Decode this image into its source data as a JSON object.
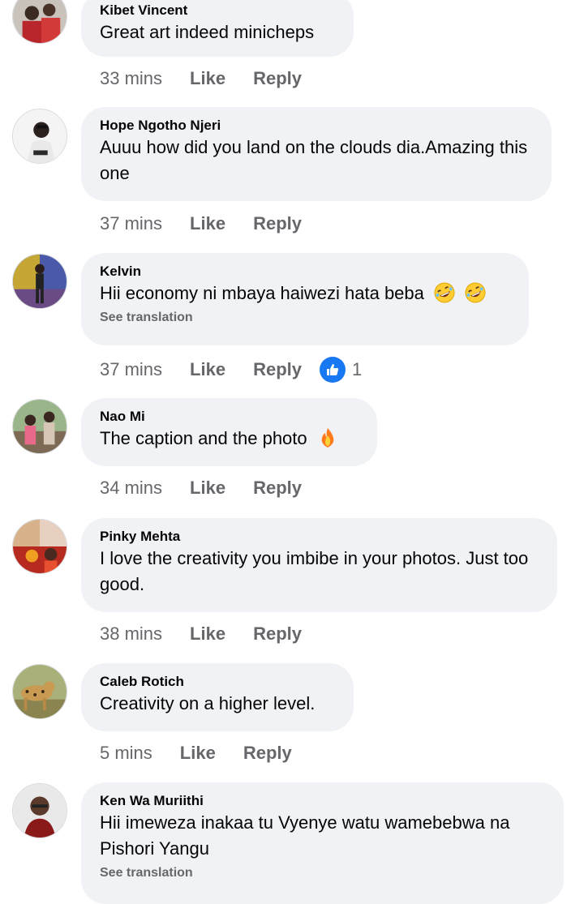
{
  "comments": [
    {
      "author": "Kibet Vincent",
      "text": "Great art indeed minicheps",
      "time": "33 mins",
      "like": "Like",
      "reply": "Reply"
    },
    {
      "author": "Hope Ngotho Njeri",
      "text": "Auuu how did you land on the clouds dia.Amazing this one",
      "time": "37 mins",
      "like": "Like",
      "reply": "Reply"
    },
    {
      "author": "Kelvin",
      "text": "Hii economy ni mbaya haiwezi hata beba",
      "emoji": [
        "rolling-on-floor-laughing-emoji",
        "rolling-on-floor-laughing-emoji"
      ],
      "see_translation": "See translation",
      "time": "37 mins",
      "like": "Like",
      "reply": "Reply",
      "reaction_count": "1"
    },
    {
      "author": "Nao Mi",
      "text": "The caption and the photo",
      "emoji": [
        "fire-emoji"
      ],
      "time": "34 mins",
      "like": "Like",
      "reply": "Reply"
    },
    {
      "author": "Pinky Mehta",
      "text": "I love the creativity you imbibe in your photos. Just too good.",
      "time": "38 mins",
      "like": "Like",
      "reply": "Reply"
    },
    {
      "author": "Caleb Rotich",
      "text": "Creativity on a higher level.",
      "time": "5 mins",
      "like": "Like",
      "reply": "Reply"
    },
    {
      "author": "Ken Wa Muriithi",
      "text": "Hii imeweza inakaa tu Vyenye watu wamebebwa na Pishori Yangu",
      "see_translation": "See translation"
    }
  ],
  "colors": {
    "bubble": "#f0f2f5",
    "meta_text": "#65676b",
    "like_blue": "#1877f2"
  }
}
